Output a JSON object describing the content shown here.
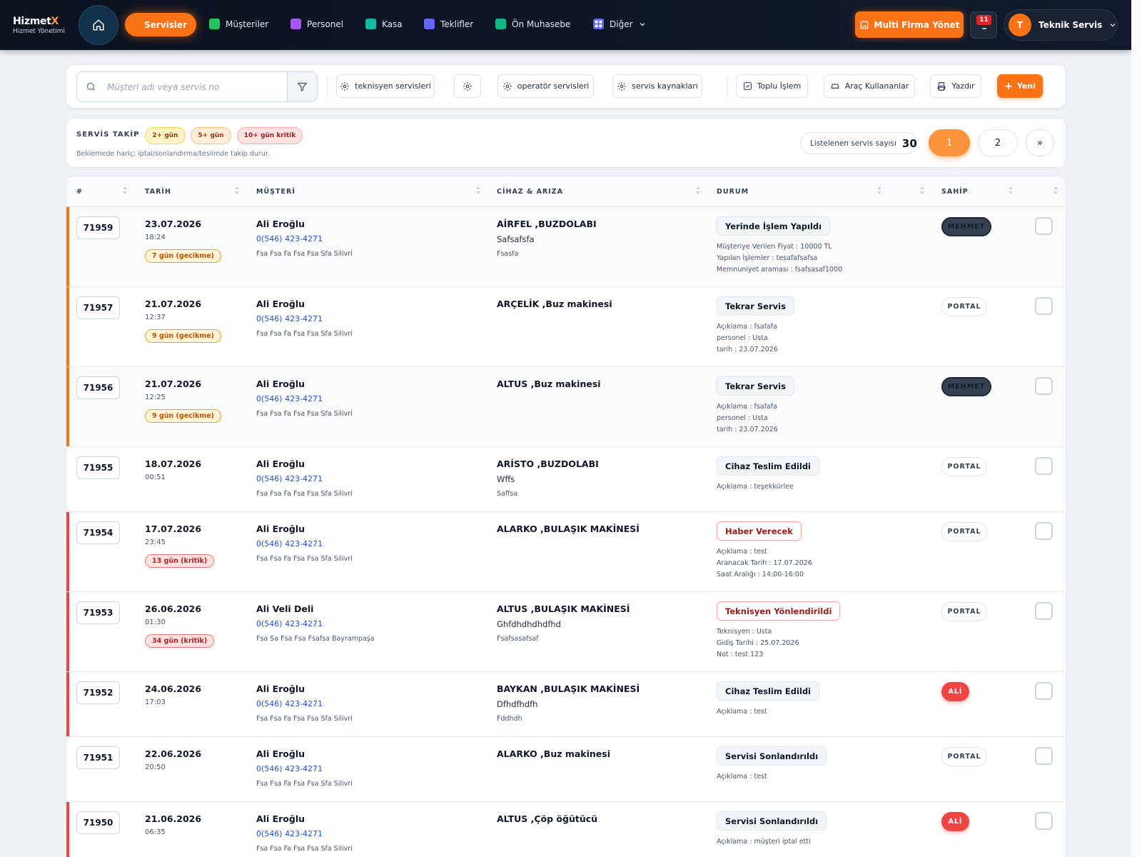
{
  "brand": {
    "name_main": "Hizmet",
    "name_x": "X",
    "subtitle": "Hizmet Yönetimi"
  },
  "nav": {
    "active": "Servisler",
    "items": [
      {
        "label": "Müşteriler",
        "color": "#22c55e"
      },
      {
        "label": "Personel",
        "color": "#a855f7"
      },
      {
        "label": "Kasa",
        "color": "#14b8a6"
      },
      {
        "label": "Teklifler",
        "color": "#6366f1"
      },
      {
        "label": "Ön Muhasebe",
        "color": "#10b981"
      },
      {
        "label": "Diğer",
        "color": "#6366f1"
      }
    ],
    "multi_firma": "Multi Firma Yönet",
    "notification_count": "11",
    "user_initial": "T",
    "user_name": "Teknik Servis"
  },
  "toolbar": {
    "search_placeholder": "Müşteri adı veya servis no",
    "buttons": [
      "teknisyen servisleri",
      "",
      "operatör servisleri",
      "servis kaynakları",
      "Toplu İşlem",
      "Araç Kullananlar",
      "Yazdır"
    ],
    "new_label": "Yeni"
  },
  "takip": {
    "title": "SERVİS TAKİP",
    "chips": [
      "2+ gün",
      "5+ gün",
      "10+ gün kritik"
    ],
    "note": "Beklemede hariç; iptal/sonlandırma/teslimde takip durur.",
    "count_label": "Listelenen servis sayısı",
    "count_value": "30",
    "pages": [
      "1",
      "2",
      "»"
    ]
  },
  "columns": [
    "#",
    "TARİH",
    "MÜŞTERİ",
    "CİHAZ & ARIZA",
    "DURUM",
    "SAHİP"
  ],
  "rows": [
    {
      "id": "71959",
      "date": "23.07.2026",
      "time": "18:24",
      "delay": "7 gün (gecikme)",
      "delay_level": "warn",
      "customer": "Ali Eroğlu",
      "phone": "0(546) 423-4271",
      "address": "Fsa Fsa Fa Fsa Fsa Sfa Silivri",
      "device": "AİRFEL ,BUZDOLABI",
      "fault1": "Safsafsfa",
      "fault2": "Fsasfa",
      "status": "Yerinde İşlem Yapıldı",
      "status_style": "gray",
      "details": [
        "Müşteriye Verilen Fiyat : 10000 TL",
        "Yapılan İşlemler : tesafafsafsa",
        "Memnuniyet araması : fsafsasaf1000"
      ],
      "owner": "MEHMET",
      "owner_style": "mehmet"
    },
    {
      "id": "71957",
      "date": "21.07.2026",
      "time": "12:37",
      "delay": "9 gün (gecikme)",
      "delay_level": "warn",
      "customer": "Ali Eroğlu",
      "phone": "0(546) 423-4271",
      "address": "Fsa Fsa Fa Fsa Fsa Sfa Silivri",
      "device": "ARÇELİK ,Buz makinesi",
      "fault1": "",
      "fault2": "",
      "status": "Tekrar Servis",
      "status_style": "gray",
      "details": [
        "Açıklama : fsafafa",
        "personel : Usta",
        "tarih : 23.07.2026"
      ],
      "owner": "PORTAL",
      "owner_style": "portal"
    },
    {
      "id": "71956",
      "date": "21.07.2026",
      "time": "12:25",
      "delay": "9 gün (gecikme)",
      "delay_level": "warn",
      "customer": "Ali Eroğlu",
      "phone": "0(546) 423-4271",
      "address": "Fsa Fsa Fa Fsa Fsa Sfa Silivri",
      "device": "ALTUS ,Buz makinesi",
      "fault1": "",
      "fault2": "",
      "status": "Tekrar Servis",
      "status_style": "gray",
      "details": [
        "Açıklama : fsafafa",
        "personel : Usta",
        "tarih : 23.07.2026"
      ],
      "owner": "MEHMET",
      "owner_style": "mehmet"
    },
    {
      "id": "71955",
      "date": "18.07.2026",
      "time": "00:51",
      "delay": "",
      "delay_level": "",
      "customer": "Ali Eroğlu",
      "phone": "0(546) 423-4271",
      "address": "Fsa Fsa Fa Fsa Fsa Sfa Silivri",
      "device": "ARİSTO ,BUZDOLABI",
      "fault1": "Wffs",
      "fault2": "Saffsa",
      "status": "Cihaz Teslim Edildi",
      "status_style": "gray",
      "details": [
        "Açıklama : teşekkürlee"
      ],
      "owner": "PORTAL",
      "owner_style": "portal"
    },
    {
      "id": "71954",
      "date": "17.07.2026",
      "time": "23:45",
      "delay": "13 gün (kritik)",
      "delay_level": "crit",
      "customer": "Ali Eroğlu",
      "phone": "0(546) 423-4271",
      "address": "Fsa Fsa Fa Fsa Fsa Sfa Silivri",
      "device": "ALARKO ,BULAŞIK MAKİNESİ",
      "fault1": "",
      "fault2": "",
      "status": "Haber Verecek",
      "status_style": "red",
      "details": [
        "Açıklama : test",
        "Aranacak Tarih : 17.07.2026",
        "Saat Aralığı : 14:00-16:00"
      ],
      "owner": "PORTAL",
      "owner_style": "portal"
    },
    {
      "id": "71953",
      "date": "26.06.2026",
      "time": "01:30",
      "delay": "34 gün (kritik)",
      "delay_level": "crit",
      "customer": "Ali Veli Deli",
      "phone": "0(546) 423-4271",
      "address": "Fsa Sa Fsa Fsa Fsafsa Bayrampaşa",
      "device": "ALTUS ,BULAŞIK MAKİNESİ",
      "fault1": "Ghfdhdhdhdfhd",
      "fault2": "Fsafsasafsaf",
      "status": "Teknisyen Yönlendirildi",
      "status_style": "red",
      "details": [
        "Teknisyen : Usta",
        "Gidiş Tarihi : 25.07.2026",
        "Not : test 123"
      ],
      "owner": "PORTAL",
      "owner_style": "portal"
    },
    {
      "id": "71952",
      "date": "24.06.2026",
      "time": "17:03",
      "delay": "",
      "delay_level": "",
      "customer": "Ali Eroğlu",
      "phone": "0(546) 423-4271",
      "address": "Fsa Fsa Fa Fsa Fsa Sfa Silivri",
      "device": "BAYKAN ,BULAŞIK MAKİNESİ",
      "fault1": "Dfhdfhdfh",
      "fault2": "Fddhdh",
      "status": "Cihaz Teslim Edildi",
      "status_style": "gray",
      "details": [
        "Açıklama : test"
      ],
      "owner": "ALİ",
      "owner_style": "ali"
    },
    {
      "id": "71951",
      "date": "22.06.2026",
      "time": "20:50",
      "delay": "",
      "delay_level": "",
      "customer": "Ali Eroğlu",
      "phone": "0(546) 423-4271",
      "address": "Fsa Fsa Fa Fsa Fsa Sfa Silivri",
      "device": "ALARKO ,Buz makinesi",
      "fault1": "",
      "fault2": "",
      "status": "Servisi Sonlandırıldı",
      "status_style": "gray",
      "details": [
        "Açıklama : test"
      ],
      "owner": "PORTAL",
      "owner_style": "portal"
    },
    {
      "id": "71950",
      "date": "21.06.2026",
      "time": "06:35",
      "delay": "",
      "delay_level": "",
      "customer": "Ali Eroğlu",
      "phone": "0(546) 423-4271",
      "address": "Fsa Fsa Fa Fsa Fsa Sfa Silivri",
      "device": "ALTUS ,Çöp öğütücü",
      "fault1": "",
      "fault2": "",
      "status": "Servisi Sonlandırıldı",
      "status_style": "gray",
      "details": [
        "Açıklama : müşteri iptal etti"
      ],
      "owner": "ALİ",
      "owner_style": "ali"
    }
  ],
  "colors": {
    "accent": "#f97316",
    "warn_bar": "#f97316",
    "crit_bar": "#ef4444"
  }
}
